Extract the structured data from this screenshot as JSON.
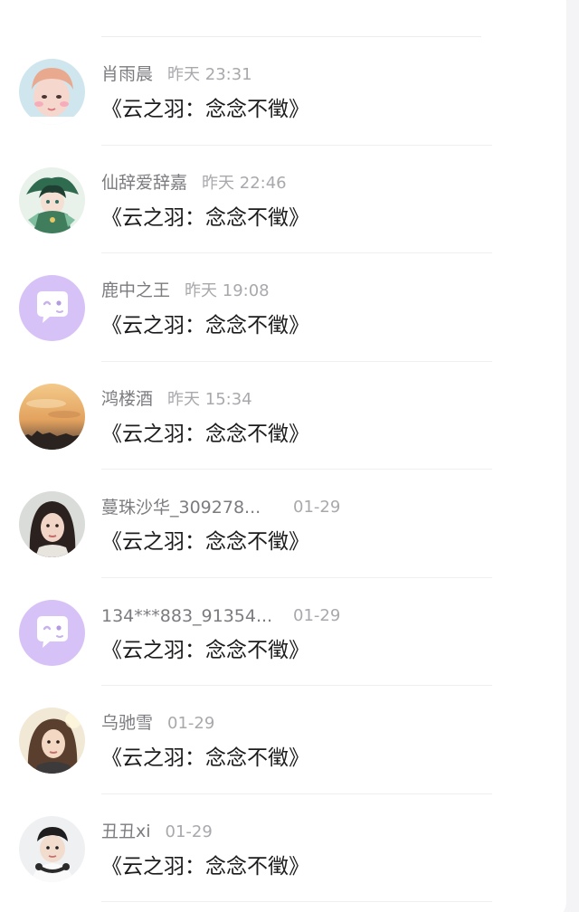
{
  "messages": [
    {
      "name": "肖雨晨",
      "time": "昨天 23:31",
      "title": "《云之羽：念念不徵》",
      "avatar": "photo-girl-pink"
    },
    {
      "name": "仙辞爱辞嘉",
      "time": "昨天 22:46",
      "title": "《云之羽：念念不徵》",
      "avatar": "anime-character"
    },
    {
      "name": "鹿中之王",
      "time": "昨天 19:08",
      "title": "《云之羽：念念不徵》",
      "avatar": "default-chat-bubble-icon"
    },
    {
      "name": "鸿楼酒",
      "time": "昨天 15:34",
      "title": "《云之羽：念念不徵》",
      "avatar": "sunset-sky"
    },
    {
      "name": "蔓珠沙华_309278...",
      "time": "01-29",
      "title": "《云之羽：念念不徵》",
      "avatar": "photo-woman-dark-hair"
    },
    {
      "name": "134***883_91354...",
      "time": "01-29",
      "title": "《云之羽：念念不徵》",
      "avatar": "default-chat-bubble-icon"
    },
    {
      "name": "乌驰雪",
      "time": "01-29",
      "title": "《云之羽：念念不徵》",
      "avatar": "photo-woman-light"
    },
    {
      "name": "丑丑xi",
      "time": "01-29",
      "title": "《云之羽：念念不徵》",
      "avatar": "photo-boy-headphones"
    }
  ],
  "colors": {
    "default_avatar_bg": "#d7c2f7",
    "name_text": "#7c7c80",
    "time_text": "#a9a9ad",
    "title_text": "#1c1c1e"
  }
}
